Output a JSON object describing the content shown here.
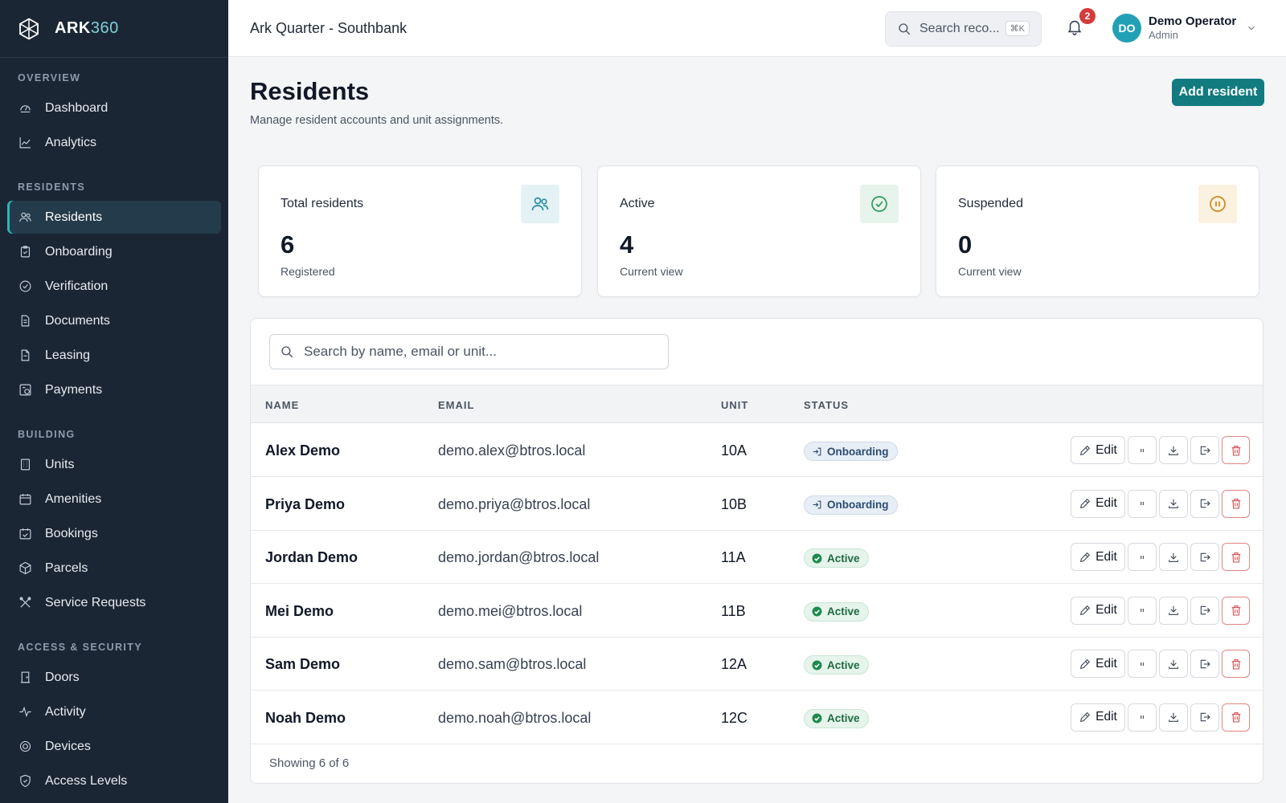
{
  "brand": {
    "name_bold": "ARK",
    "name_light": "360"
  },
  "sidebar": {
    "sections": [
      {
        "title": "OVERVIEW",
        "items": [
          {
            "label": "Dashboard",
            "icon": "dashboard-icon"
          },
          {
            "label": "Analytics",
            "icon": "chart-line-icon"
          }
        ]
      },
      {
        "title": "RESIDENTS",
        "items": [
          {
            "label": "Residents",
            "icon": "users-icon",
            "active": true
          },
          {
            "label": "Onboarding",
            "icon": "clipboard-icon"
          },
          {
            "label": "Verification",
            "icon": "check-circle-icon"
          },
          {
            "label": "Documents",
            "icon": "document-icon"
          },
          {
            "label": "Leasing",
            "icon": "file-icon"
          },
          {
            "label": "Payments",
            "icon": "payment-icon"
          }
        ]
      },
      {
        "title": "BUILDING",
        "items": [
          {
            "label": "Units",
            "icon": "building-icon"
          },
          {
            "label": "Amenities",
            "icon": "calendar-icon"
          },
          {
            "label": "Bookings",
            "icon": "calendar-check-icon"
          },
          {
            "label": "Parcels",
            "icon": "package-icon"
          },
          {
            "label": "Service Requests",
            "icon": "tools-icon"
          }
        ]
      },
      {
        "title": "ACCESS & SECURITY",
        "items": [
          {
            "label": "Doors",
            "icon": "door-icon"
          },
          {
            "label": "Activity",
            "icon": "activity-icon"
          },
          {
            "label": "Devices",
            "icon": "device-icon"
          },
          {
            "label": "Access Levels",
            "icon": "shield-icon"
          }
        ]
      }
    ]
  },
  "header": {
    "site_title": "Ark Quarter - Southbank",
    "search_placeholder": "Search reco...",
    "search_shortcut": "⌘K",
    "notifications_count": "2",
    "user": {
      "initials": "DO",
      "name": "Demo Operator",
      "role": "Admin"
    }
  },
  "page": {
    "title": "Residents",
    "subtitle": "Manage resident accounts and unit assignments.",
    "add_button": "Add resident"
  },
  "stats": [
    {
      "label": "Total residents",
      "value": "6",
      "note": "Registered",
      "icon": "users-icon",
      "color": "#2a8fa3",
      "bg": "#e4f2f5"
    },
    {
      "label": "Active",
      "value": "4",
      "note": "Current view",
      "icon": "check-circle-icon",
      "color": "#2e9a5e",
      "bg": "#e7f4ec"
    },
    {
      "label": "Suspended",
      "value": "0",
      "note": "Current view",
      "icon": "pause-circle-icon",
      "color": "#c98a1a",
      "bg": "#fbf1e0"
    }
  ],
  "table": {
    "search_placeholder": "Search by name, email or unit...",
    "columns": {
      "name": "NAME",
      "email": "EMAIL",
      "unit": "UNIT",
      "status": "STATUS"
    },
    "edit_label": "Edit",
    "rows": [
      {
        "name": "Alex Demo",
        "email": "demo.alex@btros.local",
        "unit": "10A",
        "status": "Onboarding"
      },
      {
        "name": "Priya Demo",
        "email": "demo.priya@btros.local",
        "unit": "10B",
        "status": "Onboarding"
      },
      {
        "name": "Jordan Demo",
        "email": "demo.jordan@btros.local",
        "unit": "11A",
        "status": "Active"
      },
      {
        "name": "Mei Demo",
        "email": "demo.mei@btros.local",
        "unit": "11B",
        "status": "Active"
      },
      {
        "name": "Sam Demo",
        "email": "demo.sam@btros.local",
        "unit": "12A",
        "status": "Active"
      },
      {
        "name": "Noah Demo",
        "email": "demo.noah@btros.local",
        "unit": "12C",
        "status": "Active"
      }
    ],
    "footer": "Showing 6 of 6"
  }
}
